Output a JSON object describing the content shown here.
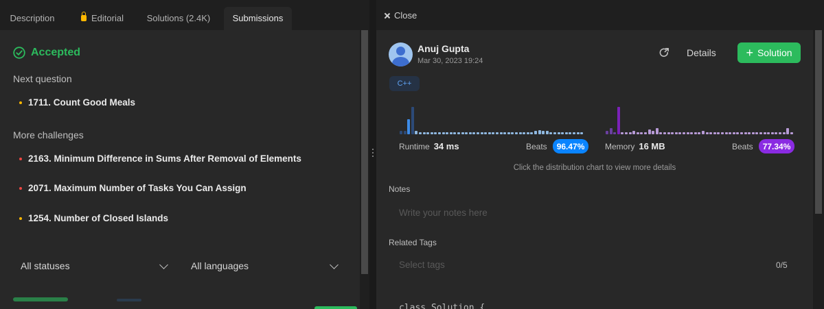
{
  "tabs": [
    {
      "label": "Description",
      "active": false
    },
    {
      "label": "Editorial",
      "active": false,
      "icon": "lock-icon"
    },
    {
      "label": "Solutions (2.4K)",
      "active": false
    },
    {
      "label": "Submissions",
      "active": true
    }
  ],
  "result": {
    "status": "Accepted",
    "color": "#2cbb5d",
    "icon": "check-circle-icon"
  },
  "next_question": {
    "label": "Next question",
    "items": [
      {
        "title": "1711. Count Good Meals",
        "difficulty": "medium"
      }
    ]
  },
  "more_challenges": {
    "label": "More challenges",
    "items": [
      {
        "title": "2163. Minimum Difference in Sums After Removal of Elements",
        "difficulty": "hard"
      },
      {
        "title": "2071. Maximum Number of Tasks You Can Assign",
        "difficulty": "hard"
      },
      {
        "title": "1254. Number of Closed Islands",
        "difficulty": "medium"
      }
    ]
  },
  "filters": {
    "status": "All statuses",
    "language": "All languages"
  },
  "panel": {
    "close_label": "Close",
    "user": {
      "name": "Anuj Gupta",
      "date": "Mar 30, 2023 19:24"
    },
    "details_label": "Details",
    "solution_label": "Solution",
    "language": "C++",
    "runtime": {
      "label": "Runtime",
      "value": "34 ms",
      "beats_label": "Beats",
      "beats": "96.47%",
      "badge_color": "#0a84ff",
      "distribution": [
        0.12,
        0.12,
        0.55,
        1.0,
        0.12,
        0.08,
        0.08,
        0.08,
        0.08,
        0.08,
        0.08,
        0.08,
        0.08,
        0.08,
        0.08,
        0.08,
        0.08,
        0.08,
        0.08,
        0.08,
        0.08,
        0.08,
        0.08,
        0.08,
        0.08,
        0.08,
        0.08,
        0.08,
        0.08,
        0.08,
        0.08,
        0.08,
        0.08,
        0.08,
        0.08,
        0.12,
        0.15,
        0.12,
        0.12,
        0.08,
        0.08,
        0.08,
        0.08,
        0.08,
        0.08,
        0.08,
        0.08,
        0.08
      ],
      "highlight_index": 3
    },
    "memory": {
      "label": "Memory",
      "value": "16 MB",
      "beats_label": "Beats",
      "beats": "77.34%",
      "badge_color": "#8a2be2",
      "distribution": [
        0.12,
        0.22,
        0.08,
        1.0,
        0.08,
        0.08,
        0.08,
        0.12,
        0.08,
        0.08,
        0.08,
        0.18,
        0.12,
        0.22,
        0.08,
        0.08,
        0.08,
        0.08,
        0.08,
        0.08,
        0.08,
        0.08,
        0.08,
        0.08,
        0.08,
        0.12,
        0.08,
        0.08,
        0.08,
        0.08,
        0.08,
        0.08,
        0.08,
        0.08,
        0.08,
        0.08,
        0.08,
        0.08,
        0.08,
        0.08,
        0.08,
        0.08,
        0.08,
        0.08,
        0.08,
        0.08,
        0.08,
        0.22,
        0.08
      ],
      "highlight_index": 3
    },
    "hint": "Click the distribution chart to view more details",
    "notes_label": "Notes",
    "notes_placeholder": "Write your notes here",
    "tags_label": "Related Tags",
    "tags_placeholder": "Select tags",
    "tags_count": "0/5",
    "code_first_line": "class Solution {"
  }
}
